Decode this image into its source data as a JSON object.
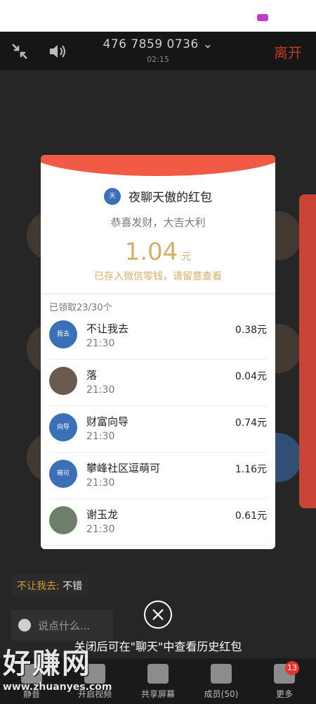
{
  "call": {
    "number": "476 7859 0736",
    "timer": "02:15",
    "leave_label": "离开"
  },
  "chat": {
    "sender": "不让我去:",
    "message": "不错",
    "input_placeholder": "说点什么..."
  },
  "close_hint": "关闭后可在\"聊天\"中查看历史红包",
  "bottom_bar": {
    "items": [
      {
        "label": "静音",
        "icon": "mic-icon"
      },
      {
        "label": "开启视频",
        "icon": "video-icon"
      },
      {
        "label": "共享屏幕",
        "icon": "share-screen-icon"
      },
      {
        "label": "成员(50)",
        "icon": "members-icon"
      },
      {
        "label": "更多",
        "icon": "menu-icon"
      }
    ],
    "more_badge": "13"
  },
  "watermark": {
    "text": "好赚网",
    "url": "www.zhuanyes.com"
  },
  "red_packet": {
    "sender_avatar_text": "天",
    "title": "夜聊天傲的红包",
    "greeting": "恭喜发财，大吉大利",
    "amount": "1.04",
    "unit": "元",
    "saved_note": "已存入微信零钱，请留意查看",
    "received_count": "已领取23/30个",
    "entries": [
      {
        "avatar_text": "我去",
        "name": "不让我去",
        "time": "21:30",
        "amount": "0.38元"
      },
      {
        "avatar_text": "",
        "name": "落",
        "time": "21:30",
        "amount": "0.04元"
      },
      {
        "avatar_text": "向导",
        "name": "财富向导",
        "time": "21:30",
        "amount": "0.74元"
      },
      {
        "avatar_text": "萌可",
        "name": "攀峰社区逗萌可",
        "time": "21:30",
        "amount": "1.16元"
      },
      {
        "avatar_text": "",
        "name": "谢玉龙",
        "time": "21:30",
        "amount": "0.61元"
      }
    ]
  },
  "colors": {
    "accent_red": "#f15a44",
    "gold": "#d4b06c",
    "leave_red": "#c0392b"
  }
}
